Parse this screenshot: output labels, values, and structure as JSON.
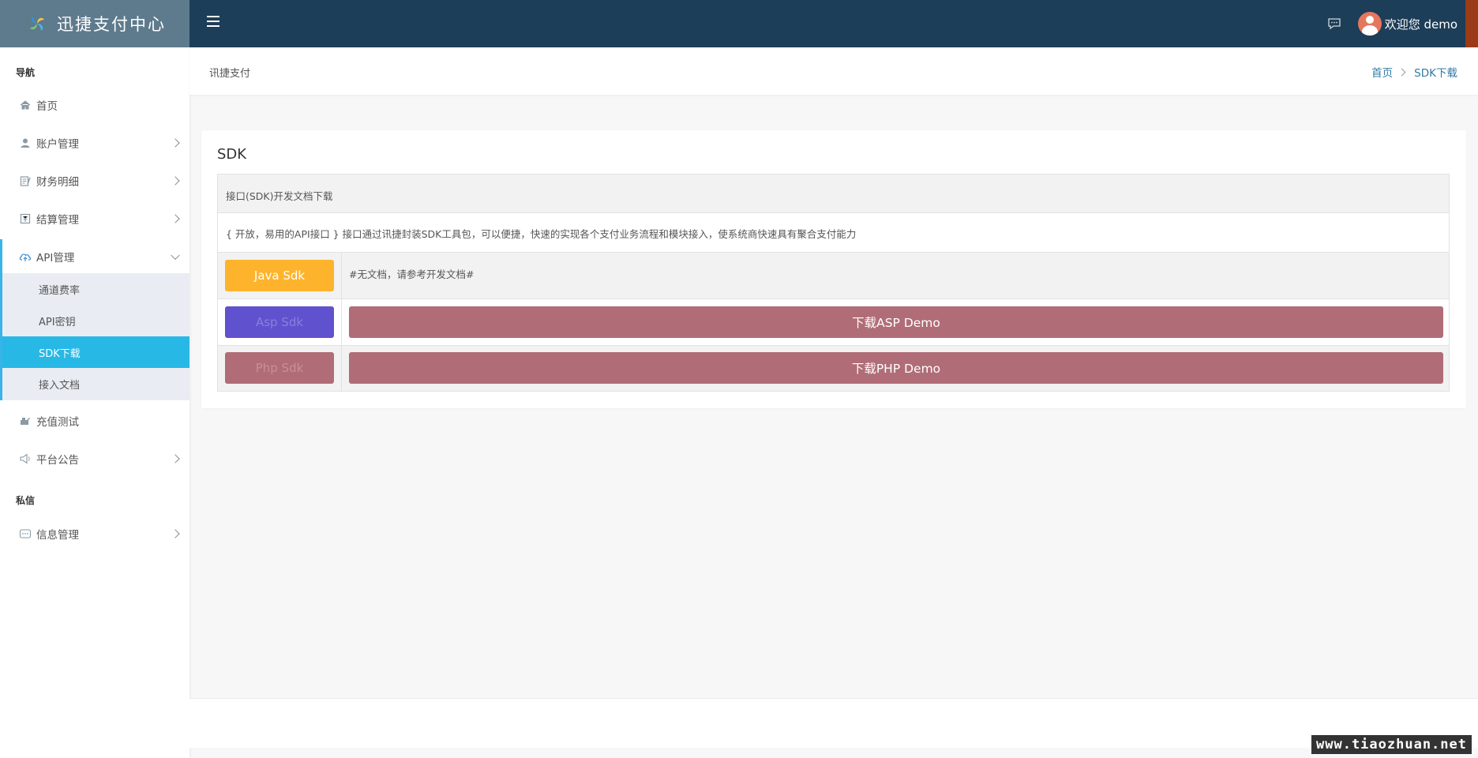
{
  "brand": {
    "name": "迅捷支付中心",
    "logo_icon": "pinwheel-icon"
  },
  "header": {
    "welcome": "欢迎您 demo",
    "menu_icon": "hamburger-icon",
    "chat_icon": "chat-icon"
  },
  "sidebar": {
    "section_nav": "导航",
    "section_msg": "私信",
    "items": [
      {
        "label": "首页",
        "icon": "home-icon"
      },
      {
        "label": "账户管理",
        "icon": "user-icon"
      },
      {
        "label": "财务明细",
        "icon": "ledger-icon"
      },
      {
        "label": "结算管理",
        "icon": "settle-icon"
      },
      {
        "label": "API管理",
        "icon": "cloud-icon"
      },
      {
        "label": "充值测试",
        "icon": "recharge-icon"
      },
      {
        "label": "平台公告",
        "icon": "speaker-icon"
      },
      {
        "label": "信息管理",
        "icon": "message-icon"
      }
    ],
    "api_submenu": [
      {
        "label": "通道费率"
      },
      {
        "label": "API密钥"
      },
      {
        "label": "SDK下载",
        "active": true
      },
      {
        "label": "接入文档"
      }
    ]
  },
  "breadcrumb": {
    "title": "讯捷支付",
    "home": "首页",
    "current": "SDK下载"
  },
  "card": {
    "title": "SDK",
    "header_row": "接口(SDK)开发文档下载",
    "desc_row": "{ 开放，易用的API接口 } 接口通过讯捷封装SDK工具包，可以便捷，快速的实现各个支付业务流程和模块接入，使系统商快速具有聚合支付能力",
    "rows": [
      {
        "sdk": "Java Sdk",
        "content": "#无文档，请参考开发文档#"
      },
      {
        "sdk": "Asp Sdk",
        "download": "下载ASP Demo"
      },
      {
        "sdk": "Php Sdk",
        "download": "下载PHP Demo"
      }
    ]
  },
  "watermark": "www.tiaozhuan.net",
  "colors": {
    "topbar": "#1d3e58",
    "brand_bg": "#5e7b8d",
    "accent": "#27b8e5",
    "java": "#fdb42c",
    "asp": "#6051cf",
    "download": "#b06d77"
  }
}
